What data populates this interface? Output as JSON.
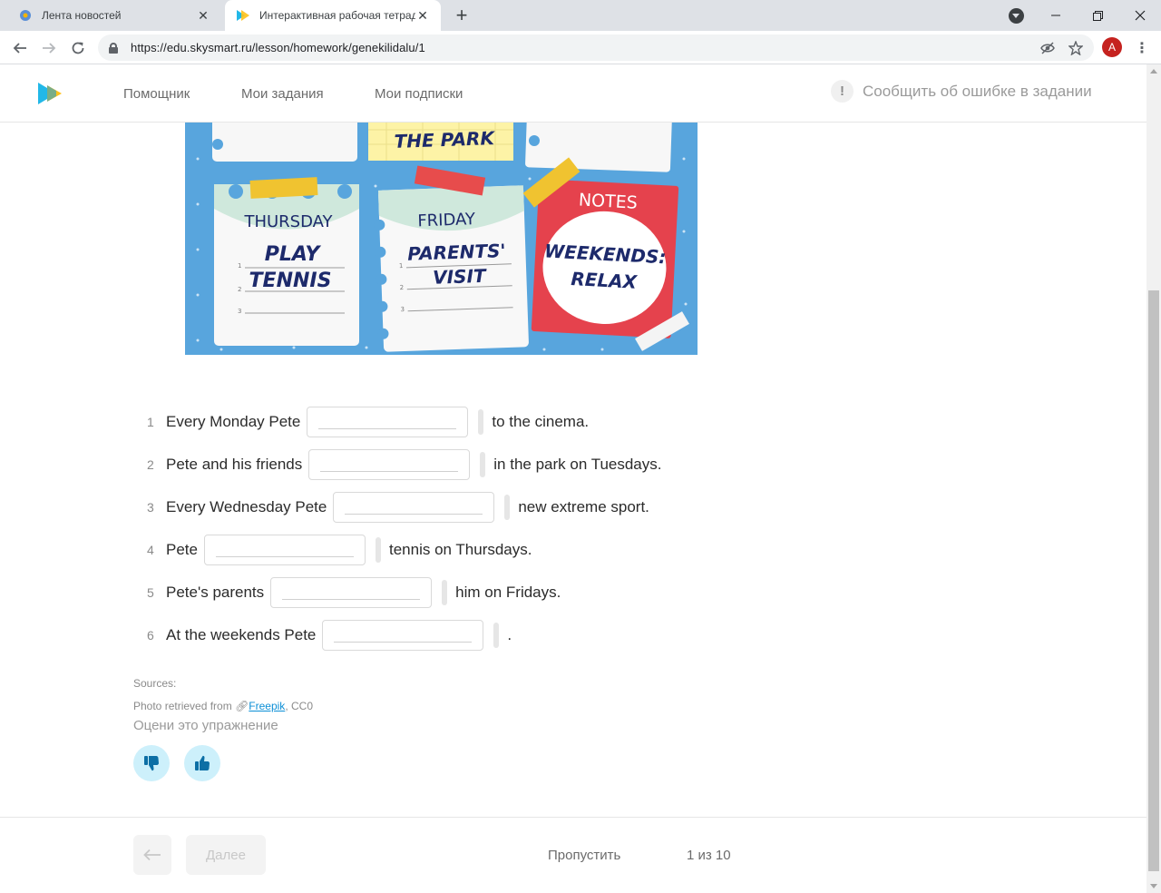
{
  "browser": {
    "tabs": [
      {
        "title": "Лента новостей",
        "active": false
      },
      {
        "title": "Интерактивная рабочая тетрадь",
        "active": true
      }
    ],
    "url": "https://edu.skysmart.ru/lesson/homework/genekilidalu/1",
    "profile_initial": "A"
  },
  "site": {
    "nav": [
      "Помощник",
      "Мои задания",
      "Мои подписки"
    ],
    "report_label": "Сообщить об ошибке в задании",
    "brand_colors": {
      "blue": "#22b8e8",
      "yellow": "#ffc21b",
      "accent": "#0c8fd6"
    }
  },
  "illustration": {
    "cards": {
      "park": "THE PARK",
      "thursday_day": "THURSDAY",
      "thursday_line1": "PLAY",
      "thursday_line2": "TENNIS",
      "friday_day": "FRIDAY",
      "friday_line1": "PARENTS'",
      "friday_line2": "VISIT",
      "notes_title": "NOTES",
      "notes_line1": "WEEKENDS:",
      "notes_line2": "RELAX"
    }
  },
  "exercise": {
    "items": [
      {
        "number": "1",
        "before": "Every Monday Pete",
        "after": "to the cinema."
      },
      {
        "number": "2",
        "before": "Pete and his friends",
        "after": "in the park on Tuesdays."
      },
      {
        "number": "3",
        "before": "Every Wednesday Pete",
        "after": "new extreme sport."
      },
      {
        "number": "4",
        "before": "Pete",
        "after": "tennis on Thursdays."
      },
      {
        "number": "5",
        "before": "Pete's parents",
        "after": "him on Fridays."
      },
      {
        "number": "6",
        "before": "At the weekends Pete",
        "after": "."
      }
    ],
    "sources_label": "Sources:",
    "credit_prefix": "Photo retrieved from",
    "credit_link": "Freepik",
    "credit_license": ", CC0",
    "rate_label": "Оцени это упражнение"
  },
  "footer": {
    "next_label": "Далее",
    "skip_label": "Пропустить",
    "pager": "1 из 10"
  }
}
